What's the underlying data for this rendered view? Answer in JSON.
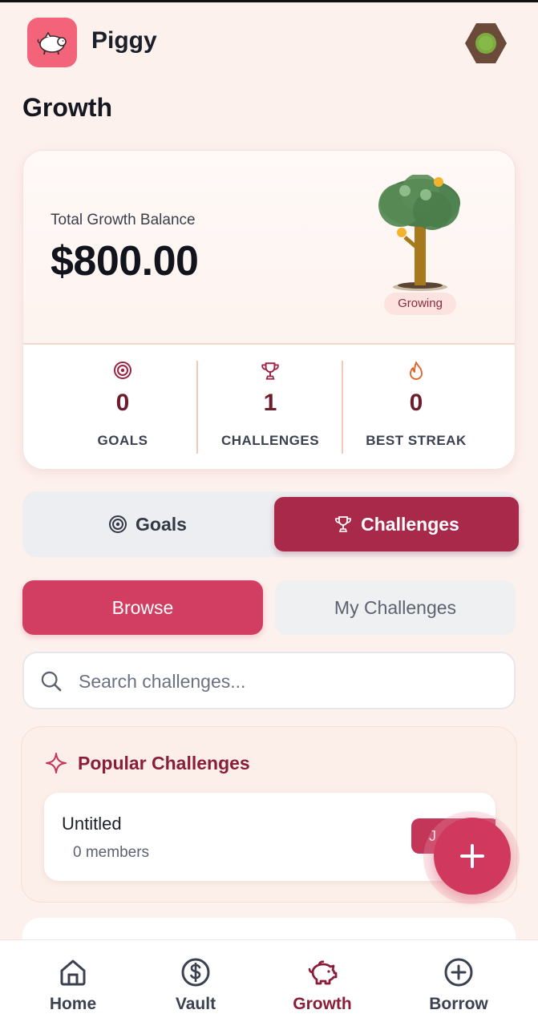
{
  "header": {
    "app_name": "Piggy",
    "page_title": "Growth"
  },
  "balance": {
    "label": "Total Growth Balance",
    "value": "$800.00",
    "tree_status": "Growing"
  },
  "stats": [
    {
      "icon": "target-icon",
      "value": "0",
      "label": "GOALS"
    },
    {
      "icon": "trophy-icon",
      "value": "1",
      "label": "CHALLENGES"
    },
    {
      "icon": "flame-icon",
      "value": "0",
      "label": "BEST STREAK"
    }
  ],
  "segment": {
    "goals_label": "Goals",
    "challenges_label": "Challenges",
    "active": "Challenges"
  },
  "subtabs": {
    "browse_label": "Browse",
    "my_label": "My Challenges",
    "active": "Browse"
  },
  "search": {
    "placeholder": "Search challenges...",
    "value": ""
  },
  "popular": {
    "title": "Popular Challenges",
    "items": [
      {
        "name": "Untitled",
        "members": "0 members",
        "join_label": "J"
      }
    ]
  },
  "nav": [
    {
      "icon": "home-icon",
      "label": "Home",
      "active": false
    },
    {
      "icon": "dollar-circle-icon",
      "label": "Vault",
      "active": false
    },
    {
      "icon": "piggy-bank-icon",
      "label": "Growth",
      "active": true
    },
    {
      "icon": "plus-circle-icon",
      "label": "Borrow",
      "active": false
    }
  ],
  "colors": {
    "brand_primary": "#a8294a",
    "brand_accent": "#d23e62",
    "logo_bg": "#f3647a",
    "background": "#fdf1ee"
  }
}
